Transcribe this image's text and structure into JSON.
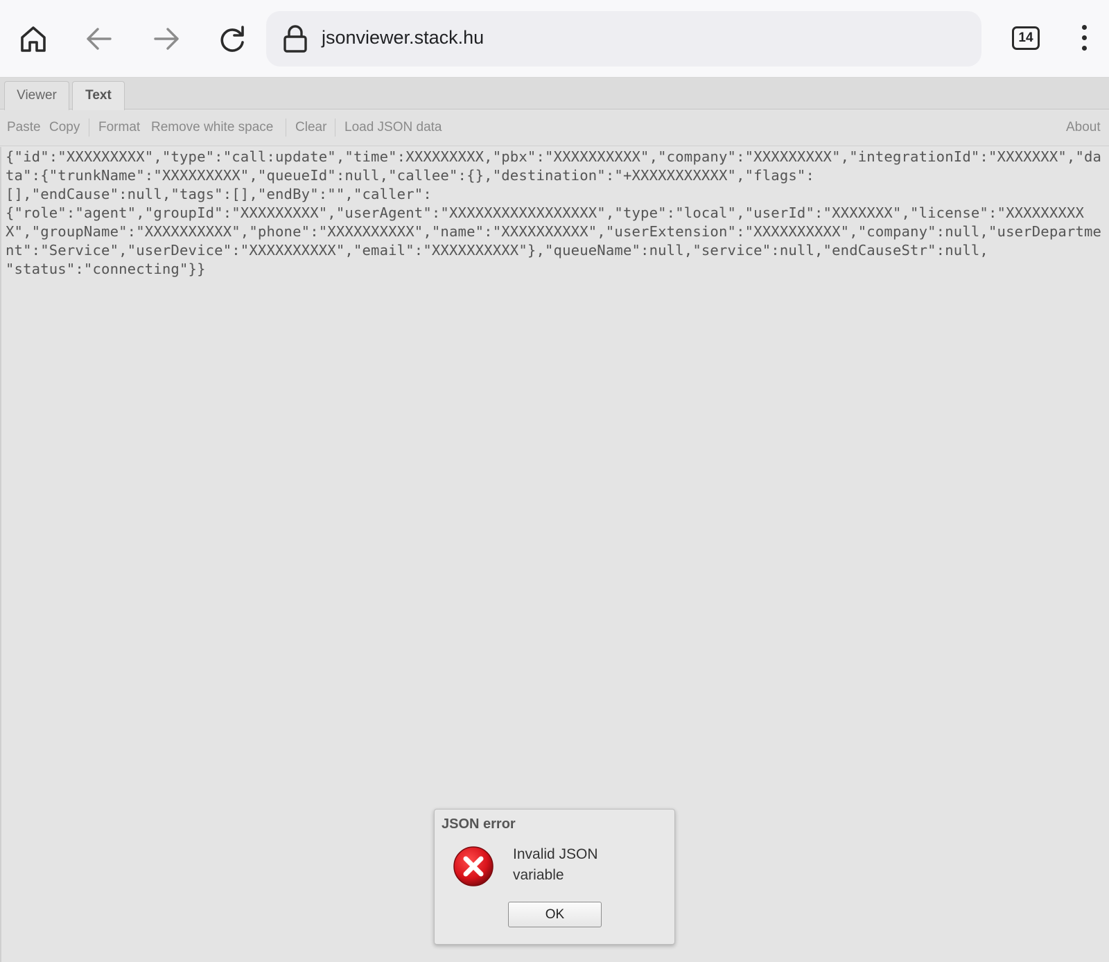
{
  "browser": {
    "url": "jsonviewer.stack.hu",
    "tab_count": "14",
    "icons": {
      "home": "home-icon",
      "back": "arrow-left-icon",
      "forward": "arrow-right-icon",
      "reload": "reload-icon",
      "lock": "lock-icon",
      "menu": "kebab-menu-icon"
    }
  },
  "tabs": [
    {
      "label": "Viewer",
      "active": false
    },
    {
      "label": "Text",
      "active": true
    }
  ],
  "toolbar": {
    "paste": "Paste",
    "copy": "Copy",
    "format": "Format",
    "remove_ws": "Remove white space",
    "clear": "Clear",
    "load": "Load JSON data",
    "about": "About"
  },
  "editor": {
    "text": "{\"id\":\"XXXXXXXXX\",\"type\":\"call:update\",\"time\":XXXXXXXXX,\"pbx\":\"XXXXXXXXXX\",\"company\":\"XXXXXXXXX\",\"integrationId\":\"XXXXXXX\",\"data\":{\"trunkName\":\"XXXXXXXXX\",\"queueId\":null,\"callee\":{},\"destination\":\"+XXXXXXXXXXX\",\"flags\":\n[],\"endCause\":null,\"tags\":[],\"endBy\":\"\",\"caller\":\n{\"role\":\"agent\",\"groupId\":\"XXXXXXXXX\",\"userAgent\":\"XXXXXXXXXXXXXXXXX\",\"type\":\"local\",\"userId\":\"XXXXXXX\",\"license\":\"XXXXXXXXXX\",\"groupName\":\"XXXXXXXXXX\",\"phone\":\"XXXXXXXXXX\",\"name\":\"XXXXXXXXXX\",\"userExtension\":\"XXXXXXXXXX\",\"company\":null,\"userDepartment\":\"Service\",\"userDevice\":\"XXXXXXXXXX\",\"email\":\"XXXXXXXXXX\"},\"queueName\":null,\"service\":null,\"endCauseStr\":null,\n\"status\":\"connecting\"}}"
  },
  "dialog": {
    "title": "JSON error",
    "message": "Invalid JSON variable",
    "ok_label": "OK",
    "icon": "error-icon",
    "icon_color": "#d8131b"
  }
}
